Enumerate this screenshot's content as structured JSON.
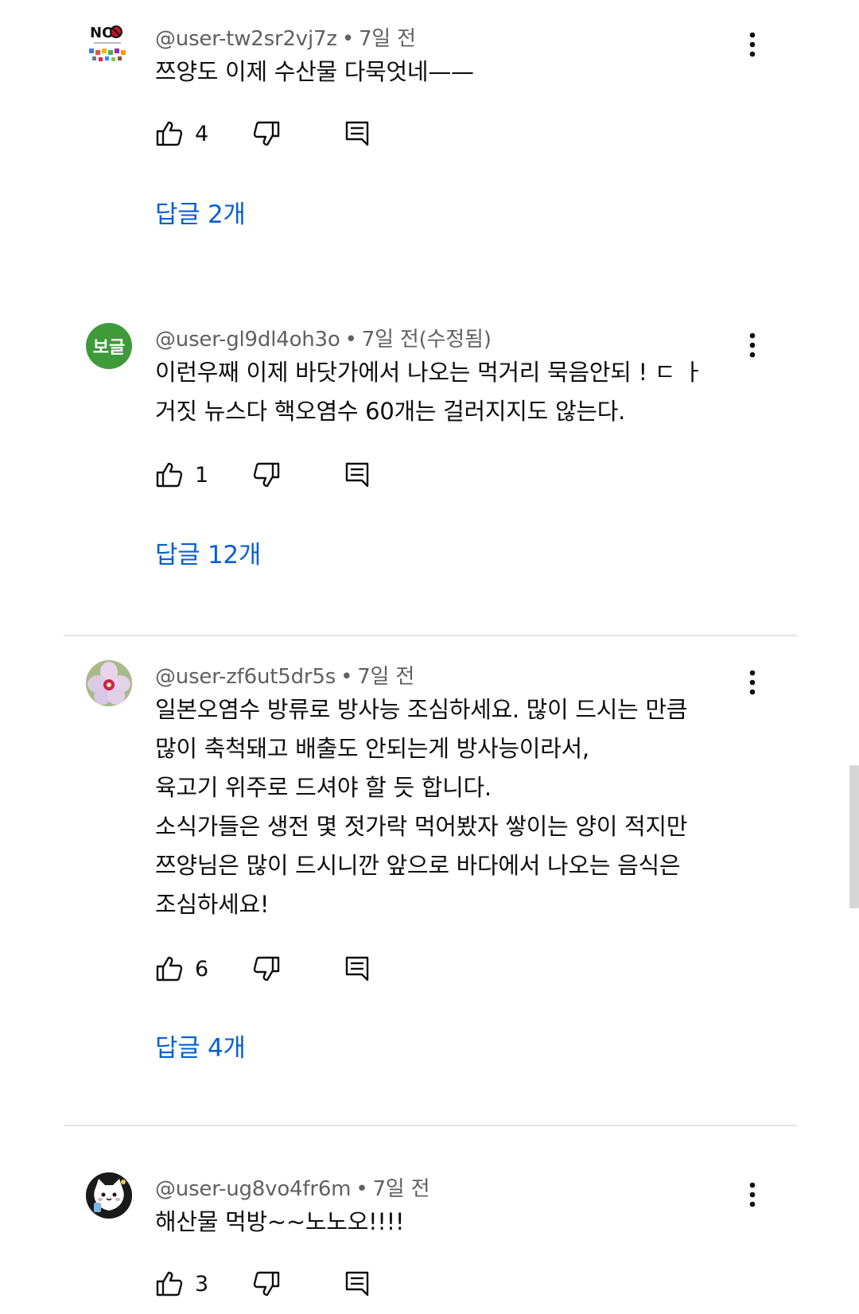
{
  "comments": [
    {
      "author": "@user-tw2sr2vj7z",
      "time": "7일 전",
      "avatar": {
        "type": "image",
        "desc": "no-logo",
        "text": "NO"
      },
      "lines": [
        "쯔양도 이제 수산물 다묵엇네——"
      ],
      "likes": "4",
      "replies": "답글 2개"
    },
    {
      "author": "@user-gl9dl4oh3o",
      "time": "7일 전(수정됨)",
      "avatar": {
        "type": "initial",
        "text": "보글",
        "color": "#3f9a3a"
      },
      "lines": [
        "이런우째 이제 바닷가에서 나오는 먹거리 묵음안되 ! ㄷ ㅏ",
        "거짓 뉴스다 핵오염수 60개는 걸러지지도 않는다."
      ],
      "likes": "1",
      "replies": "답글 12개"
    },
    {
      "author": "@user-zf6ut5dr5s",
      "time": "7일 전",
      "avatar": {
        "type": "image",
        "desc": "flower"
      },
      "lines": [
        "일본오염수 방류로 방사능 조심하세요. 많이 드시는 만큼",
        "많이 축척돼고 배출도 안되는게 방사능이라서,",
        "육고기 위주로 드셔야 할 듯 합니다.",
        "소식가들은 생전 몇 젓가락 먹어봤자 쌓이는 양이 적지만",
        "쯔양님은 많이 드시니깐 앞으로 바다에서 나오는 음식은",
        "조심하세요!"
      ],
      "likes": "6",
      "replies": "답글 4개"
    },
    {
      "author": "@user-ug8vo4fr6m",
      "time": "7일 전",
      "avatar": {
        "type": "image",
        "desc": "cartoon-cat"
      },
      "lines": [
        "해산물 먹방~~노노오!!!!"
      ],
      "likes": "3",
      "replies": ""
    }
  ],
  "icons": {
    "like": "thumb-up-icon",
    "dislike": "thumb-down-icon",
    "reply": "comment-icon",
    "more": "more-vert-icon"
  },
  "colors": {
    "link": "#065fd4",
    "meta": "#606060",
    "divider": "#e5e5e5"
  }
}
